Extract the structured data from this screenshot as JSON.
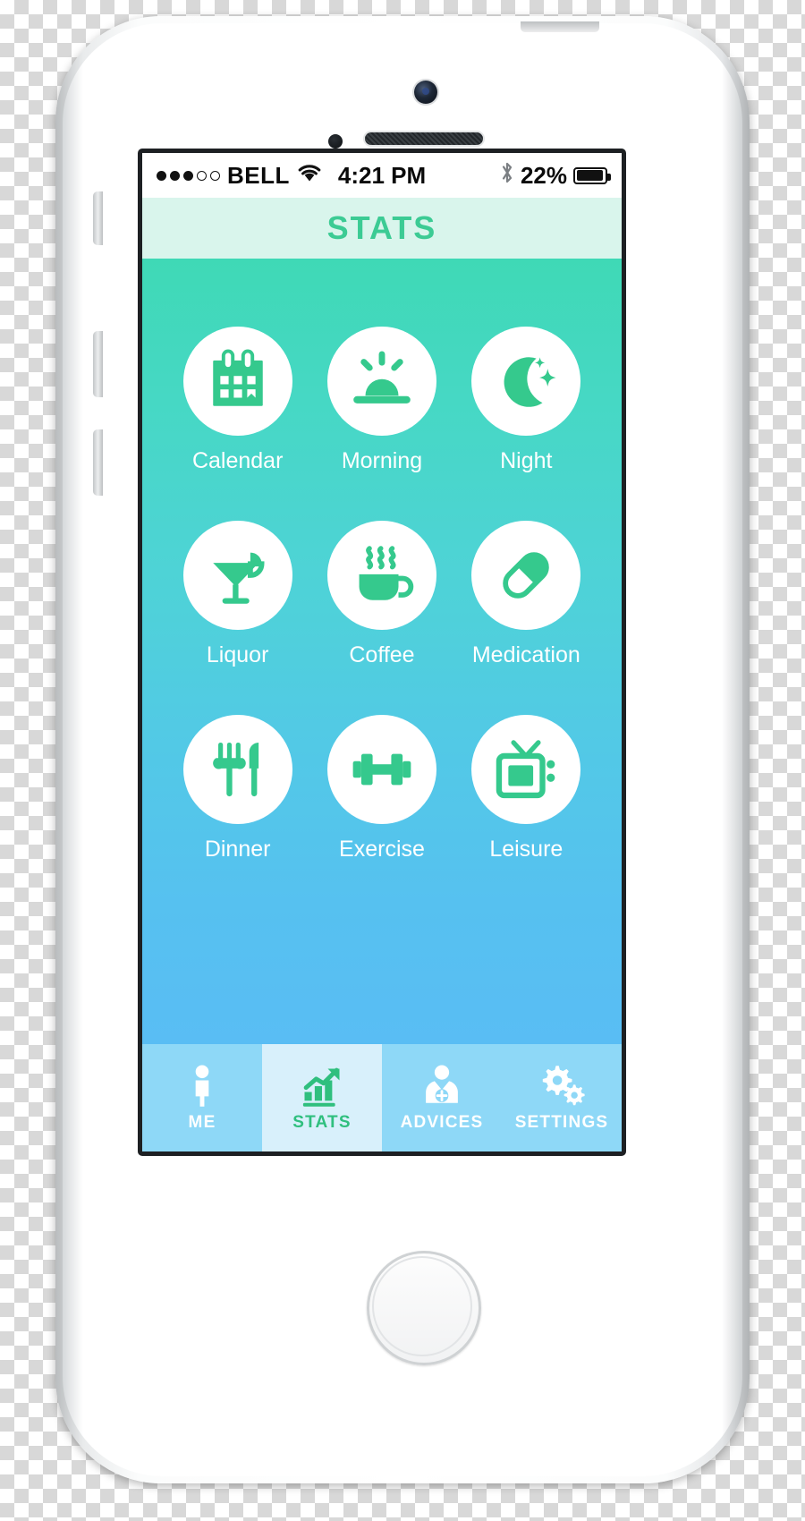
{
  "status_bar": {
    "signal_dots": [
      "on",
      "on",
      "on",
      "off",
      "off"
    ],
    "carrier": "BELL",
    "wifi_icon": "wifi-icon",
    "time": "4:21 PM",
    "bluetooth_icon": "bluetooth-icon",
    "battery_percent": "22%",
    "battery_fill_ratio": 0.86
  },
  "header": {
    "title": "STATS"
  },
  "grid": {
    "items": [
      {
        "label": "Calendar",
        "icon": "calendar-icon"
      },
      {
        "label": "Morning",
        "icon": "sunrise-icon"
      },
      {
        "label": "Night",
        "icon": "moon-stars-icon"
      },
      {
        "label": "Liquor",
        "icon": "cocktail-glass-icon"
      },
      {
        "label": "Coffee",
        "icon": "coffee-cup-icon"
      },
      {
        "label": "Medication",
        "icon": "pill-capsule-icon"
      },
      {
        "label": "Dinner",
        "icon": "fork-knife-icon"
      },
      {
        "label": "Exercise",
        "icon": "dumbbell-icon"
      },
      {
        "label": "Leisure",
        "icon": "television-icon"
      }
    ]
  },
  "tab_bar": {
    "tabs": [
      {
        "label": "ME",
        "icon": "person-icon",
        "active": false
      },
      {
        "label": "STATS",
        "icon": "bar-chart-icon",
        "active": true
      },
      {
        "label": "ADVICES",
        "icon": "doctor-icon",
        "active": false
      },
      {
        "label": "SETTINGS",
        "icon": "gears-icon",
        "active": false
      }
    ]
  },
  "colors": {
    "accent_green": "#2fbf7e",
    "icon_green": "#35c98d",
    "header_bg": "#d9f5ec",
    "gradient_top": "#3fd9b6",
    "gradient_bottom": "#59bdf4",
    "tab_bg": "#8ed8f7",
    "tab_active_bg": "#d8f0fb"
  }
}
